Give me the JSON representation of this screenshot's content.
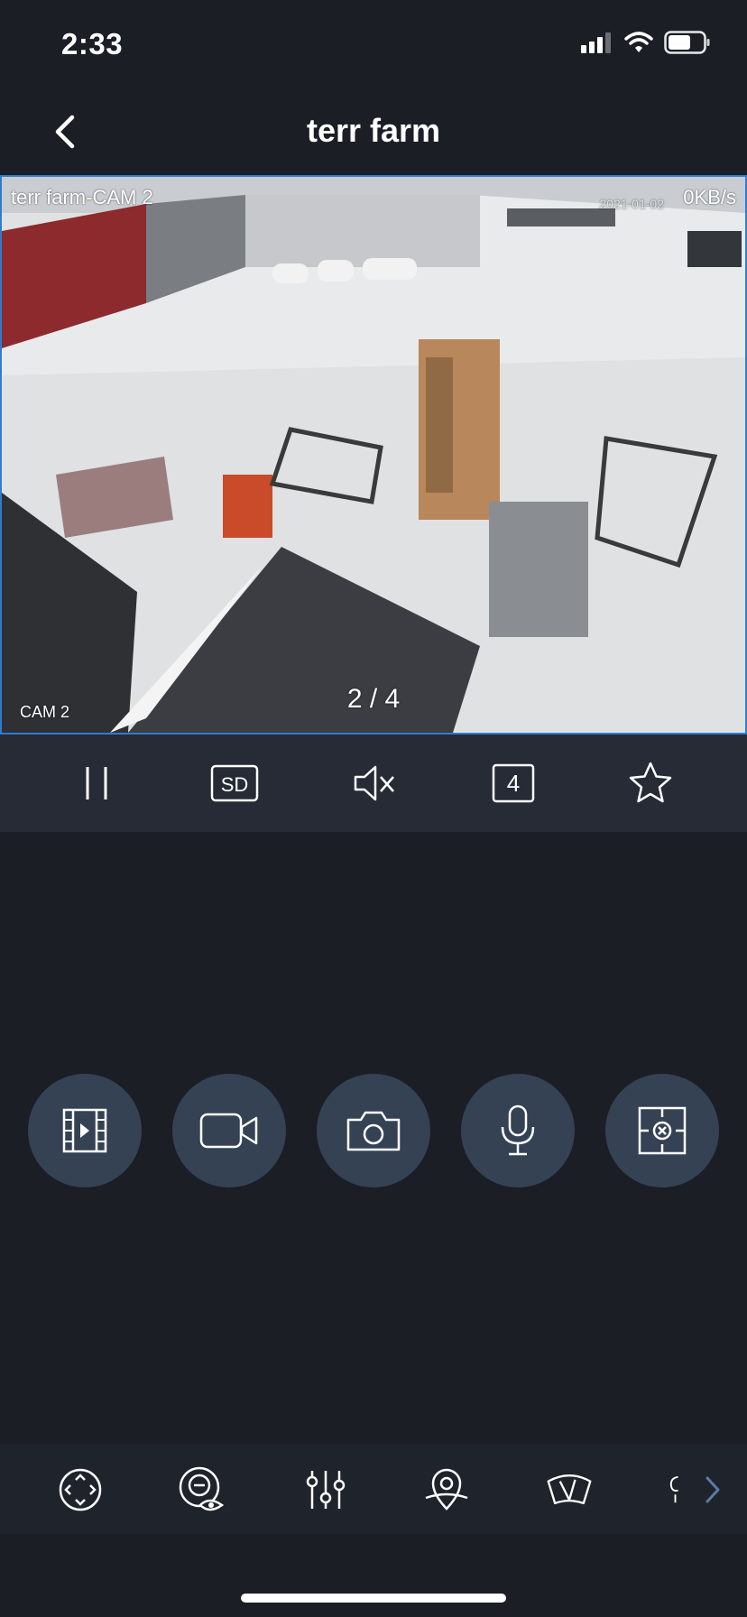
{
  "status_bar": {
    "time": "2:33",
    "icons": [
      "cellular-signal-icon",
      "wifi-icon",
      "battery-icon"
    ]
  },
  "nav": {
    "title": "terr farm",
    "back_icon": "chevron-left-icon"
  },
  "video": {
    "osd_name": "terr farm-CAM 2",
    "osd_rate": "0KB/s",
    "osd_date": "2021-01-02",
    "osd_cam": "CAM 2",
    "page_indicator": "2 / 4"
  },
  "controls": {
    "quality_label": "SD",
    "split_count": "4",
    "icons": [
      "pause-icon",
      "quality-icon",
      "mute-icon",
      "split-screen-icon",
      "favorite-star-icon"
    ]
  },
  "actions": {
    "icons": [
      "playback-film-icon",
      "record-video-icon",
      "snapshot-camera-icon",
      "microphone-icon",
      "close-stream-icon"
    ]
  },
  "toolbar": {
    "icons": [
      "ptz-direction-icon",
      "eye-icon",
      "adjust-sliders-icon",
      "location-pin-icon",
      "wiper-icon",
      "more-icon",
      "chevron-right-icon"
    ]
  },
  "colors": {
    "background": "#1b1e25",
    "bar": "#262b35",
    "action_button": "#354254",
    "video_border": "#2f7cd0",
    "chevron_accent": "#5b7ba8"
  }
}
